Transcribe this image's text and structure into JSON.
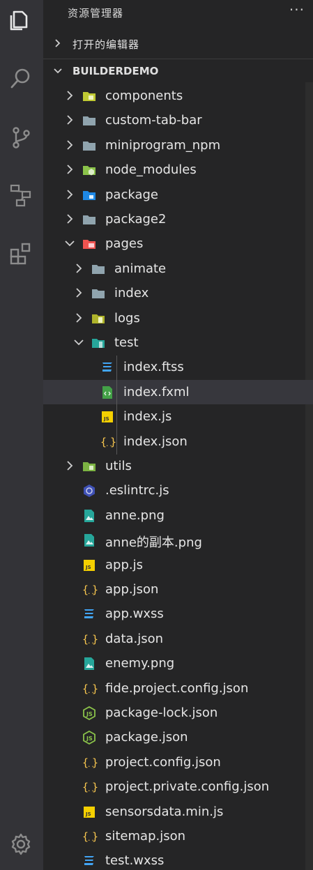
{
  "activity_bar": {
    "items": [
      {
        "icon": "files-icon",
        "active": true
      },
      {
        "icon": "search-icon",
        "active": false
      },
      {
        "icon": "source-control-icon",
        "active": false
      },
      {
        "icon": "remote-explorer-icon",
        "active": false
      },
      {
        "icon": "extensions-icon",
        "active": false
      }
    ],
    "bottom": [
      {
        "icon": "settings-gear-icon"
      }
    ]
  },
  "explorer": {
    "title": "资源管理器",
    "more_label": "···",
    "open_editors_label": "打开的编辑器",
    "workspace_label": "BUILDERDEMO",
    "selected": "index.fxml"
  },
  "tree": [
    {
      "name": "components",
      "depth": 0,
      "kind": "folder",
      "icon": "folder-components-icon",
      "expanded": false
    },
    {
      "name": "custom-tab-bar",
      "depth": 0,
      "kind": "folder",
      "icon": "folder-icon",
      "expanded": false
    },
    {
      "name": "miniprogram_npm",
      "depth": 0,
      "kind": "folder",
      "icon": "folder-icon",
      "expanded": false
    },
    {
      "name": "node_modules",
      "depth": 0,
      "kind": "folder",
      "icon": "folder-node-icon",
      "expanded": false
    },
    {
      "name": "package",
      "depth": 0,
      "kind": "folder",
      "icon": "folder-package-icon",
      "expanded": false
    },
    {
      "name": "package2",
      "depth": 0,
      "kind": "folder",
      "icon": "folder-icon",
      "expanded": false
    },
    {
      "name": "pages",
      "depth": 0,
      "kind": "folder",
      "icon": "folder-pages-icon",
      "expanded": true
    },
    {
      "name": "animate",
      "depth": 1,
      "kind": "folder",
      "icon": "folder-icon",
      "expanded": false
    },
    {
      "name": "index",
      "depth": 1,
      "kind": "folder",
      "icon": "folder-icon",
      "expanded": false
    },
    {
      "name": "logs",
      "depth": 1,
      "kind": "folder",
      "icon": "folder-logs-icon",
      "expanded": false
    },
    {
      "name": "test",
      "depth": 1,
      "kind": "folder",
      "icon": "folder-test-icon",
      "expanded": true
    },
    {
      "name": "index.ftss",
      "depth": 2,
      "kind": "file",
      "icon": "css-file-icon"
    },
    {
      "name": "index.fxml",
      "depth": 2,
      "kind": "file",
      "icon": "xml-file-icon"
    },
    {
      "name": "index.js",
      "depth": 2,
      "kind": "file",
      "icon": "js-file-icon"
    },
    {
      "name": "index.json",
      "depth": 2,
      "kind": "file",
      "icon": "json-file-icon"
    },
    {
      "name": "utils",
      "depth": 0,
      "kind": "folder",
      "icon": "folder-utils-icon",
      "expanded": false
    },
    {
      "name": ".eslintrc.js",
      "depth": 0,
      "kind": "file",
      "icon": "eslint-file-icon"
    },
    {
      "name": "anne.png",
      "depth": 0,
      "kind": "file",
      "icon": "image-file-icon"
    },
    {
      "name": "anne的副本.png",
      "depth": 0,
      "kind": "file",
      "icon": "image-file-icon"
    },
    {
      "name": "app.js",
      "depth": 0,
      "kind": "file",
      "icon": "js-file-icon"
    },
    {
      "name": "app.json",
      "depth": 0,
      "kind": "file",
      "icon": "json-file-icon"
    },
    {
      "name": "app.wxss",
      "depth": 0,
      "kind": "file",
      "icon": "css-file-icon"
    },
    {
      "name": "data.json",
      "depth": 0,
      "kind": "file",
      "icon": "json-file-icon"
    },
    {
      "name": "enemy.png",
      "depth": 0,
      "kind": "file",
      "icon": "image-file-icon"
    },
    {
      "name": "fide.project.config.json",
      "depth": 0,
      "kind": "file",
      "icon": "json-file-icon"
    },
    {
      "name": "package-lock.json",
      "depth": 0,
      "kind": "file",
      "icon": "nodejs-file-icon"
    },
    {
      "name": "package.json",
      "depth": 0,
      "kind": "file",
      "icon": "nodejs-file-icon"
    },
    {
      "name": "project.config.json",
      "depth": 0,
      "kind": "file",
      "icon": "json-file-icon"
    },
    {
      "name": "project.private.config.json",
      "depth": 0,
      "kind": "file",
      "icon": "json-file-icon"
    },
    {
      "name": "sensorsdata.min.js",
      "depth": 0,
      "kind": "file",
      "icon": "js-file-icon"
    },
    {
      "name": "sitemap.json",
      "depth": 0,
      "kind": "file",
      "icon": "json-file-icon"
    },
    {
      "name": "test.wxss",
      "depth": 0,
      "kind": "file",
      "icon": "css-file-icon"
    }
  ],
  "colors": {
    "activity_bar_bg": "#333337",
    "sidebar_bg": "#252526",
    "selection_bg": "#37373d",
    "text": "#e6e6e6",
    "folder_gray": "#90a4ae",
    "json_yellow": "#f9c74f",
    "css_blue": "#42a5f5",
    "image_teal": "#26a69a",
    "js_yellow": "#f5d000",
    "node_green": "#8bc34a"
  }
}
